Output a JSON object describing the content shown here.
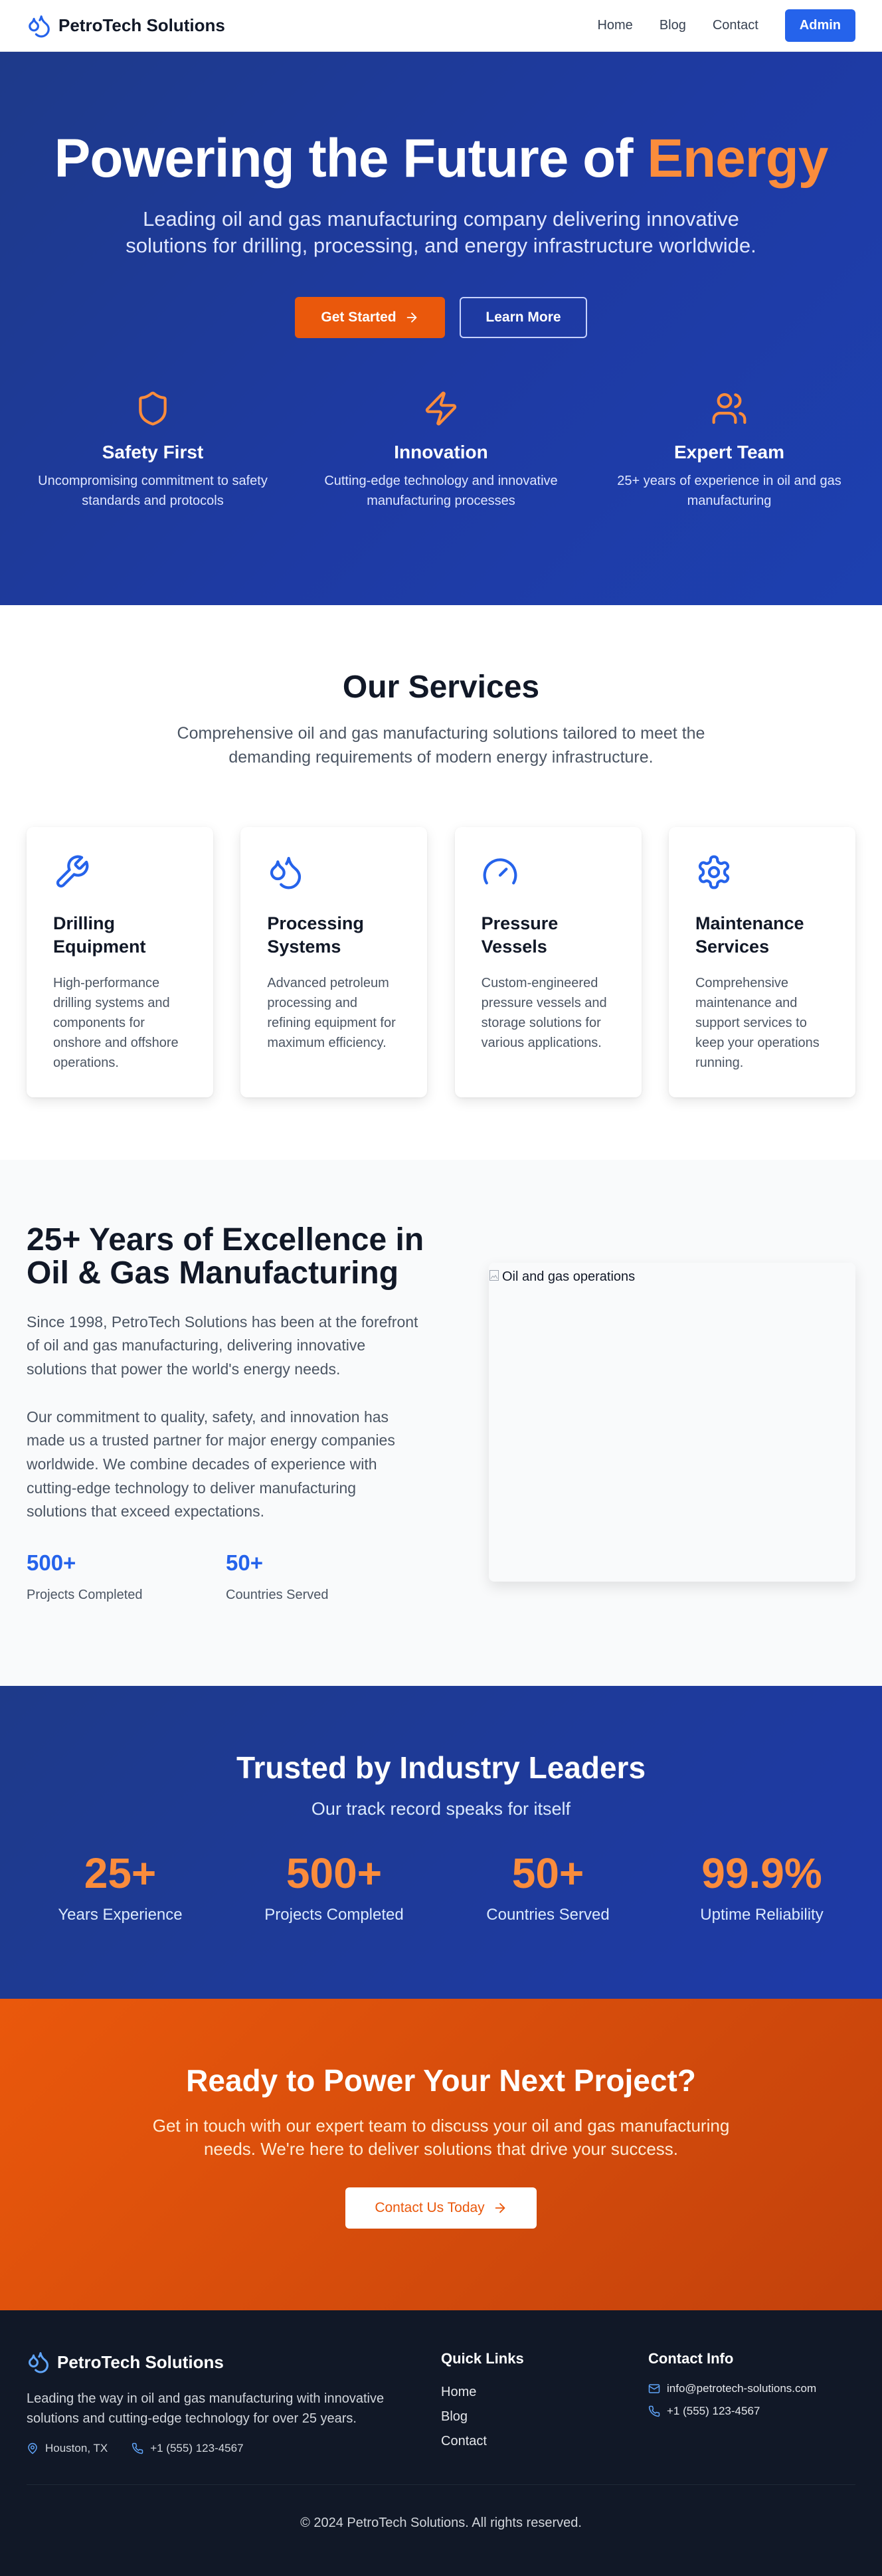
{
  "colors": {
    "brand_blue": "#2563eb",
    "accent_orange": "#fb8c3c",
    "cta_orange": "#ea580c",
    "hero_navy": "#1e3a8a",
    "footer_dark": "#111827"
  },
  "nav": {
    "brand": "PetroTech Solutions",
    "logo_icon": "droplets-icon",
    "links": [
      "Home",
      "Blog",
      "Contact"
    ],
    "admin_label": "Admin"
  },
  "hero": {
    "title_main": "Powering the Future of ",
    "title_accent": "Energy",
    "subtitle": "Leading oil and gas manufacturing company delivering innovative solutions for drilling, processing, and energy infrastructure worldwide.",
    "primary_button": "Get Started",
    "secondary_button": "Learn More",
    "features": [
      {
        "icon": "shield-icon",
        "title": "Safety First",
        "desc": "Uncompromising commitment to safety standards and protocols"
      },
      {
        "icon": "lightning-icon",
        "title": "Innovation",
        "desc": "Cutting-edge technology and innovative manufacturing processes"
      },
      {
        "icon": "users-icon",
        "title": "Expert Team",
        "desc": "25+ years of experience in oil and gas manufacturing"
      }
    ]
  },
  "services": {
    "title": "Our Services",
    "subtitle": "Comprehensive oil and gas manufacturing solutions tailored to meet the demanding requirements of modern energy infrastructure.",
    "cards": [
      {
        "icon": "wrench-icon",
        "title": "Drilling Equipment",
        "desc": "High-performance drilling systems and components for onshore and offshore operations."
      },
      {
        "icon": "droplets-icon",
        "title": "Processing Systems",
        "desc": "Advanced petroleum processing and refining equipment for maximum efficiency."
      },
      {
        "icon": "gauge-icon",
        "title": "Pressure Vessels",
        "desc": "Custom-engineered pressure vessels and storage solutions for various applications."
      },
      {
        "icon": "gear-icon",
        "title": "Maintenance Services",
        "desc": "Comprehensive maintenance and support services to keep your operations running."
      }
    ]
  },
  "about": {
    "title": "25+ Years of Excellence in Oil & Gas Manufacturing",
    "paragraph1": "Since 1998, PetroTech Solutions has been at the forefront of oil and gas manufacturing, delivering innovative solutions that power the world's energy needs.",
    "paragraph2": "Our commitment to quality, safety, and innovation has made us a trusted partner for major energy companies worldwide. We combine decades of experience with cutting-edge technology to deliver manufacturing solutions that exceed expectations.",
    "stats": [
      {
        "value": "500+",
        "label": "Projects Completed"
      },
      {
        "value": "50+",
        "label": "Countries Served"
      }
    ],
    "image_alt": "Oil and gas operations"
  },
  "trusted": {
    "title": "Trusted by Industry Leaders",
    "subtitle": "Our track record speaks for itself",
    "stats": [
      {
        "value": "25+",
        "label": "Years Experience"
      },
      {
        "value": "500+",
        "label": "Projects Completed"
      },
      {
        "value": "50+",
        "label": "Countries Served"
      },
      {
        "value": "99.9%",
        "label": "Uptime Reliability"
      }
    ]
  },
  "cta": {
    "title": "Ready to Power Your Next Project?",
    "subtitle": "Get in touch with our expert team to discuss your oil and gas manufacturing needs. We're here to deliver solutions that drive your success.",
    "button": "Contact Us Today"
  },
  "footer": {
    "brand": "PetroTech Solutions",
    "description": "Leading the way in oil and gas manufacturing with innovative solutions and cutting-edge technology for over 25 years.",
    "location": "Houston, TX",
    "phone": "+1 (555) 123-4567",
    "quick_links_title": "Quick Links",
    "quick_links": [
      "Home",
      "Blog",
      "Contact"
    ],
    "contact_title": "Contact Info",
    "email": "info@petrotech-solutions.com",
    "contact_phone": "+1 (555) 123-4567",
    "copyright": "© 2024 PetroTech Solutions. All rights reserved."
  }
}
